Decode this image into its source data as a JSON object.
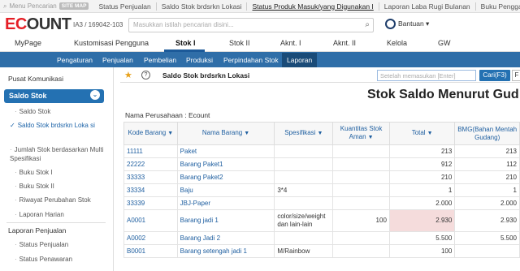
{
  "topbar": {
    "menu_search": "Menu Pencarian",
    "sitemap": "SITE MAP",
    "tabs": [
      {
        "label": "Status Penjualan"
      },
      {
        "label": "Saldo Stok brdsrkn Lokasi"
      },
      {
        "label": "Status Produk Masuk/yang Digunakan I"
      },
      {
        "label": "Laporan Laba Rugi Bulanan"
      },
      {
        "label": "Buku Penggajian"
      }
    ]
  },
  "header": {
    "logo_e": "EC",
    "logo_rest": "OUNT",
    "company_id": "IA3 / 169042-103",
    "search_placeholder": "Masukkan istilah pencarian disini...",
    "help_label": "Bantuan ▾"
  },
  "mainnav": {
    "items": [
      {
        "label": "MyPage"
      },
      {
        "label": "Kustomisasi Pengguna"
      },
      {
        "label": "Stok I"
      },
      {
        "label": "Stok II"
      },
      {
        "label": "Aknt. I"
      },
      {
        "label": "Aknt. II"
      },
      {
        "label": "Kelola"
      },
      {
        "label": "GW"
      }
    ]
  },
  "subnav": {
    "items": [
      {
        "label": "Pengaturan"
      },
      {
        "label": "Penjualan"
      },
      {
        "label": "Pembelian"
      },
      {
        "label": "Produksi"
      },
      {
        "label": "Perpindahan Stok"
      },
      {
        "label": "Laporan"
      }
    ]
  },
  "sidebar": {
    "section1": "Pusat Komunikasi",
    "selected": "Saldo Stok",
    "items": [
      {
        "label": "Saldo Stok"
      },
      {
        "label": "Saldo Stok brdsrkn Loka si"
      },
      {
        "label": "Jumlah Stok berdasarkan Multi Spesifikasi"
      },
      {
        "label": "Buku Stok I"
      },
      {
        "label": "Buku Stok II"
      },
      {
        "label": "Riwayat Perubahan Stok"
      },
      {
        "label": "Laporan Harian"
      }
    ],
    "section2": "Laporan Penjualan",
    "items2": [
      {
        "label": "Status Penjualan"
      },
      {
        "label": "Status Penawaran"
      }
    ]
  },
  "toolbar": {
    "title": "Saldo Stok brdsrkn Lokasi",
    "input_placeholder": "Setelah memasukan [Enter]",
    "find_label": "Cari(F3)",
    "extra_label": "F"
  },
  "report": {
    "title": "Stok Saldo Menurut Gud",
    "company": "Nama Perusahaan : Ecount"
  },
  "table": {
    "headers": [
      {
        "label": "Kode Barang"
      },
      {
        "label": "Nama Barang"
      },
      {
        "label": "Spesifikasi"
      },
      {
        "label": "Kuantitas Stok Aman"
      },
      {
        "label": "Total"
      },
      {
        "label": "BMG(Bahan Mentah Gudang)"
      }
    ],
    "rows": [
      {
        "code": "11111",
        "name": "Paket",
        "spec": "",
        "safe": "",
        "total": "213",
        "bmg": "213"
      },
      {
        "code": "22222",
        "name": "Barang Paket1",
        "spec": "",
        "safe": "",
        "total": "912",
        "bmg": "112"
      },
      {
        "code": "33333",
        "name": "Barang Paket2",
        "spec": "",
        "safe": "",
        "total": "210",
        "bmg": "210"
      },
      {
        "code": "33334",
        "name": "Baju",
        "spec": "3*4",
        "safe": "",
        "total": "1",
        "bmg": "1"
      },
      {
        "code": "33339",
        "name": "JBJ-Paper",
        "spec": "",
        "safe": "",
        "total": "2.000",
        "bmg": "2.000"
      },
      {
        "code": "A0001",
        "name": "Barang jadi 1",
        "spec": "color/size/weight dan lain-lain",
        "safe": "100",
        "total": "2.930",
        "bmg": "2.930"
      },
      {
        "code": "A0002",
        "name": "Barang Jadi 2",
        "spec": "",
        "safe": "",
        "total": "5.500",
        "bmg": "5.500"
      },
      {
        "code": "B0001",
        "name": "Barang setengah jadi 1",
        "spec": "M/Rainbow",
        "safe": "",
        "total": "100",
        "bmg": ""
      }
    ]
  },
  "colors": {
    "brand_red": "#e51f26",
    "nav_blue": "#2f6ea8",
    "link_blue": "#1f5fa0",
    "highlight_pink": "#f5dcdc"
  }
}
